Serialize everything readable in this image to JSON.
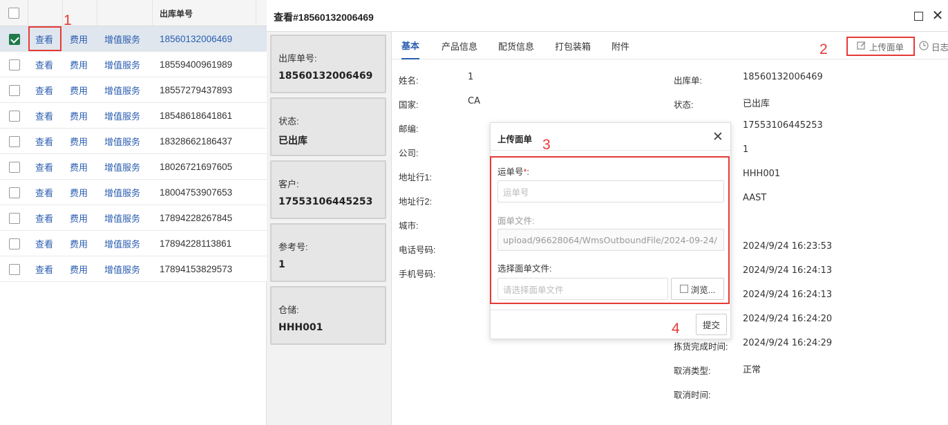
{
  "table": {
    "header_col": "出库单号",
    "rows": [
      {
        "view": "查看",
        "fee": "费用",
        "vas": "增值服务",
        "number": "18560132006469",
        "checked": true
      },
      {
        "view": "查看",
        "fee": "费用",
        "vas": "增值服务",
        "number": "18559400961989",
        "checked": false
      },
      {
        "view": "查看",
        "fee": "费用",
        "vas": "增值服务",
        "number": "18557279437893",
        "checked": false
      },
      {
        "view": "查看",
        "fee": "费用",
        "vas": "增值服务",
        "number": "18548618641861",
        "checked": false
      },
      {
        "view": "查看",
        "fee": "费用",
        "vas": "增值服务",
        "number": "18328662186437",
        "checked": false
      },
      {
        "view": "查看",
        "fee": "费用",
        "vas": "增值服务",
        "number": "18026721697605",
        "checked": false
      },
      {
        "view": "查看",
        "fee": "费用",
        "vas": "增值服务",
        "number": "18004753907653",
        "checked": false
      },
      {
        "view": "查看",
        "fee": "费用",
        "vas": "增值服务",
        "number": "17894228267845",
        "checked": false
      },
      {
        "view": "查看",
        "fee": "费用",
        "vas": "增值服务",
        "number": "17894228113861",
        "checked": false
      },
      {
        "view": "查看",
        "fee": "费用",
        "vas": "增值服务",
        "number": "17894153829573",
        "checked": false
      }
    ]
  },
  "annotations": {
    "m1": "1",
    "m2": "2",
    "m3": "3",
    "m4": "4"
  },
  "dialog": {
    "title": "查看#18560132006469",
    "cards": [
      {
        "label": "出库单号:",
        "value": "18560132006469"
      },
      {
        "label": "状态:",
        "value": "已出库"
      },
      {
        "label": "客户:",
        "value": "17553106445253"
      },
      {
        "label": "参考号:",
        "value": "1"
      },
      {
        "label": "仓储:",
        "value": "HHH001"
      }
    ],
    "tabs": [
      "基本",
      "产品信息",
      "配货信息",
      "打包装箱",
      "附件"
    ],
    "upload_label": "上传面单",
    "log_label": "日志",
    "left_fields": [
      {
        "label": "姓名:",
        "value": "1"
      },
      {
        "label": "国家:",
        "value": "CA"
      },
      {
        "label": "邮编:",
        "value": ""
      },
      {
        "label": "公司:",
        "value": ""
      },
      {
        "label": "地址行1:",
        "value": ""
      },
      {
        "label": "地址行2:",
        "value": ""
      },
      {
        "label": "城市:",
        "value": ""
      },
      {
        "label": "电话号码:",
        "value": ""
      },
      {
        "label": "手机号码:",
        "value": ""
      }
    ],
    "right_fields": [
      {
        "label": "出库单:",
        "value": "18560132006469"
      },
      {
        "label": "状态:",
        "value": "已出库"
      },
      {
        "label": "",
        "value": "17553106445253"
      },
      {
        "label": "",
        "value": "1"
      },
      {
        "label": "",
        "value": "HHH001"
      },
      {
        "label": "",
        "value": "AAST"
      },
      {
        "label": "",
        "value": ""
      },
      {
        "label": "",
        "value": "2024/9/24 16:23:53"
      },
      {
        "label": "",
        "value": "2024/9/24 16:24:13"
      },
      {
        "label": "",
        "value": "2024/9/24 16:24:13"
      },
      {
        "label": "",
        "value": "2024/9/24 16:24:20"
      },
      {
        "label": "拣货完成时间:",
        "value": "2024/9/24 16:24:29"
      },
      {
        "label": "取消类型:",
        "value": "正常"
      },
      {
        "label": "取消时间:",
        "value": ""
      }
    ]
  },
  "modal": {
    "title": "上传面单",
    "tracking_label": "运单号",
    "required_mark": "*",
    "colon": ":",
    "tracking_placeholder": "运单号",
    "file_label": "面单文件:",
    "file_value": "upload/96628064/WmsOutboundFile/2024-09-24/",
    "choose_label": "选择面单文件:",
    "choose_placeholder": "请选择面单文件",
    "browse_label": "浏览...",
    "submit_label": "提交"
  }
}
